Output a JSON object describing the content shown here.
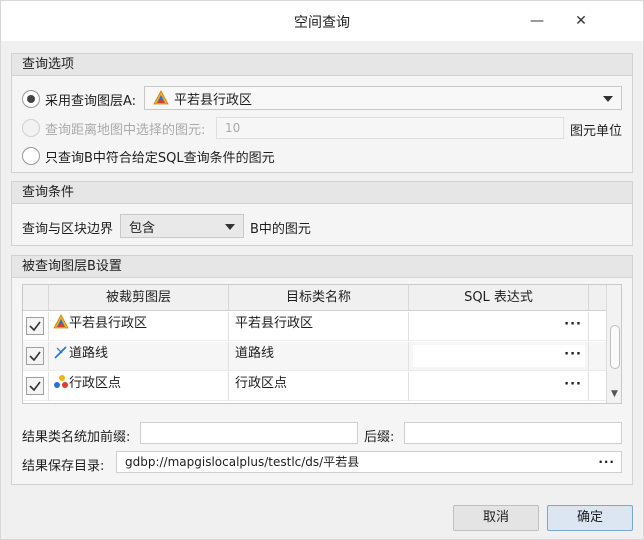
{
  "window": {
    "title": "空间查询",
    "minimize_glyph": "—",
    "close_glyph": "✕"
  },
  "query_options": {
    "header": "查询选项",
    "use_layer_a_label": "采用查询图层A:",
    "layer_a_selected": "平若县行政区",
    "distance_label": "查询距离地图中选择的图元:",
    "distance_value": "10",
    "distance_unit": "图元单位",
    "sql_only_label": "只查询B中符合给定SQL查询条件的图元"
  },
  "query_conditions": {
    "header": "查询条件",
    "label": "查询与区块边界",
    "relation_selected": "包含",
    "suffix": "B中的图元"
  },
  "layer_b": {
    "header": "被查询图层B设置",
    "columns": [
      "被裁剪图层",
      "目标类名称",
      "SQL 表达式"
    ],
    "rows": [
      {
        "checked": true,
        "icon": "region-layer-icon",
        "layer": "平若县行政区",
        "target": "平若县行政区",
        "sql": ""
      },
      {
        "checked": true,
        "icon": "line-layer-icon",
        "layer": "道路线",
        "target": "道路线",
        "sql": ""
      },
      {
        "checked": true,
        "icon": "point-layer-icon",
        "layer": "行政区点",
        "target": "行政区点",
        "sql": ""
      }
    ],
    "more_glyph": "···",
    "prefix_label": "结果类名统加前缀:",
    "prefix_value": "",
    "suffix_label": "后缀:",
    "suffix_value": "",
    "save_dir_label": "结果保存目录:",
    "save_dir_value": "gdbp://mapgislocalplus/testlc/ds/平若县"
  },
  "buttons": {
    "cancel": "取消",
    "ok": "确定"
  },
  "colors": {
    "primary_border": "#7aa7d6",
    "region_icon": "#f2b01e",
    "line_icon": "#2b6fd6",
    "point_icon": "#e23b2e"
  }
}
